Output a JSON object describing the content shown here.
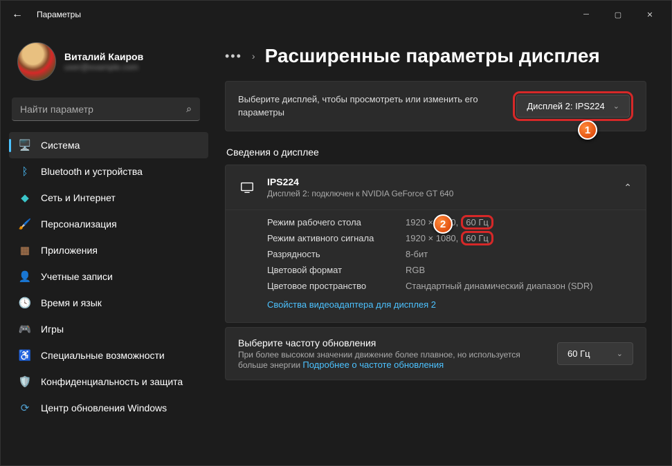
{
  "window": {
    "title": "Параметры"
  },
  "user": {
    "name": "Виталий Каиров",
    "email": "user@example.com"
  },
  "search": {
    "placeholder": "Найти параметр"
  },
  "nav": [
    {
      "label": "Система",
      "icon": "🖥️",
      "color": "#4cc2ff",
      "active": true
    },
    {
      "label": "Bluetooth и устройства",
      "icon": "ᛒ",
      "color": "#4cc2ff"
    },
    {
      "label": "Сеть и Интернет",
      "icon": "◆",
      "color": "#3ac5c9"
    },
    {
      "label": "Персонализация",
      "icon": "🖌️",
      "color": "#6a8ad6"
    },
    {
      "label": "Приложения",
      "icon": "▦",
      "color": "#c98a5a"
    },
    {
      "label": "Учетные записи",
      "icon": "👤",
      "color": "#a8c070"
    },
    {
      "label": "Время и язык",
      "icon": "🕓",
      "color": "#d0b050"
    },
    {
      "label": "Игры",
      "icon": "🎮",
      "color": "#9a9a9a"
    },
    {
      "label": "Специальные возможности",
      "icon": "♿",
      "color": "#6ab0d0"
    },
    {
      "label": "Конфиденциальность и защита",
      "icon": "🛡️",
      "color": "#9a9a9a"
    },
    {
      "label": "Центр обновления Windows",
      "icon": "⟳",
      "color": "#50a0d0"
    }
  ],
  "breadcrumb": {
    "dots": "•••",
    "chev": "›",
    "title": "Расширенные параметры дисплея"
  },
  "displaySelect": {
    "prompt": "Выберите дисплей, чтобы просмотреть или изменить его параметры",
    "value": "Дисплей 2: IPS224"
  },
  "sectionLabel": "Сведения о дисплее",
  "displayInfo": {
    "name": "IPS224",
    "sub": "Дисплей 2: подключен к NVIDIA GeForce GT 640",
    "rows": [
      {
        "key": "Режим рабочего стола",
        "val_pre": "1920 × 1080,",
        "val_hz": "60 Гц",
        "highlight": true
      },
      {
        "key": "Режим активного сигнала",
        "val_pre": "1920 × 1080,",
        "val_hz": "60 Гц",
        "highlight": true
      },
      {
        "key": "Разрядность",
        "val": "8-бит"
      },
      {
        "key": "Цветовой формат",
        "val": "RGB"
      },
      {
        "key": "Цветовое пространство",
        "val": "Стандартный динамический диапазон (SDR)"
      }
    ],
    "link": "Свойства видеоадаптера для дисплея 2"
  },
  "refresh": {
    "title": "Выберите частоту обновления",
    "sub_pre": "При более высоком значении движение более плавное, но используется больше энергии ",
    "sub_link": "Подробнее о частоте обновления",
    "value": "60 Гц"
  },
  "annotations": {
    "a1": "1",
    "a2": "2"
  }
}
